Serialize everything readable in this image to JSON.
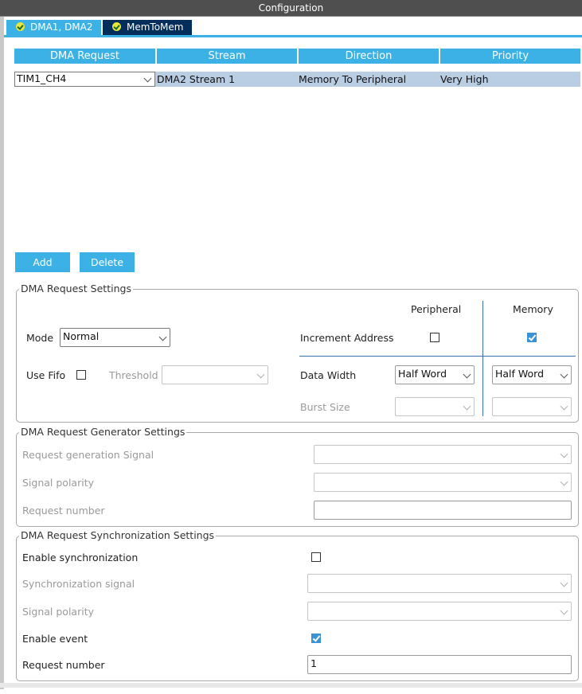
{
  "window": {
    "title": "Configuration"
  },
  "tabs": [
    {
      "label": "DMA1, DMA2",
      "active": true
    },
    {
      "label": "MemToMem",
      "active": false
    }
  ],
  "table": {
    "headers": [
      "DMA Request",
      "Stream",
      "Direction",
      "Priority"
    ],
    "rows": [
      {
        "request": "TIM1_CH4",
        "stream": "DMA2 Stream 1",
        "direction": "Memory To Peripheral",
        "priority": "Very High"
      }
    ]
  },
  "buttons": {
    "add": "Add",
    "delete": "Delete"
  },
  "request_settings": {
    "legend": "DMA Request Settings",
    "peripheral_header": "Peripheral",
    "memory_header": "Memory",
    "mode_label": "Mode",
    "mode_value": "Normal",
    "increment_label": "Increment Address",
    "increment_peripheral": false,
    "increment_memory": true,
    "use_fifo_label": "Use Fifo",
    "use_fifo": false,
    "threshold_label": "Threshold",
    "threshold_value": "",
    "data_width_label": "Data Width",
    "data_width_peripheral": "Half Word",
    "data_width_memory": "Half Word",
    "burst_size_label": "Burst Size",
    "burst_peripheral": "",
    "burst_memory": ""
  },
  "generator_settings": {
    "legend": "DMA Request Generator Settings",
    "signal_label": "Request generation Signal",
    "signal_value": "",
    "polarity_label": "Signal polarity",
    "polarity_value": "",
    "number_label": "Request number",
    "number_value": ""
  },
  "sync_settings": {
    "legend": "DMA Request Synchronization Settings",
    "enable_sync_label": "Enable synchronization",
    "enable_sync": false,
    "sync_signal_label": "Synchronization signal",
    "sync_signal_value": "",
    "polarity_label": "Signal polarity",
    "polarity_value": "",
    "enable_event_label": "Enable event",
    "enable_event": true,
    "number_label": "Request number",
    "number_value": "1"
  },
  "colors": {
    "accent": "#3cb1e6",
    "dark_tab": "#032d5b",
    "row_selected": "#b9cde3"
  }
}
